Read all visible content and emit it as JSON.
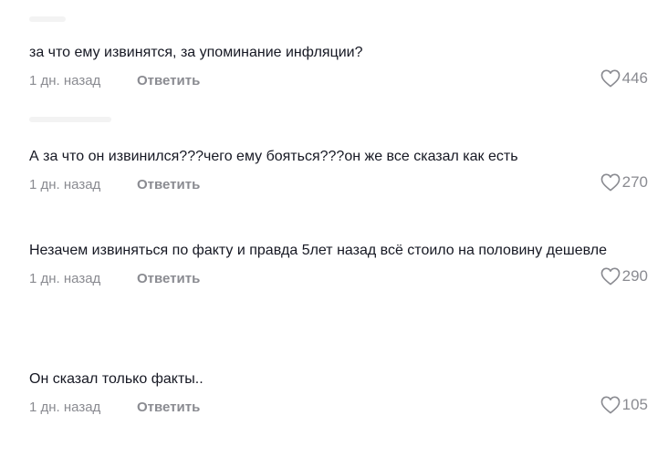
{
  "comments": [
    {
      "text": "за что ему извинятся, за упоминание инфляции?",
      "time": "1 дн. назад",
      "reply_label": "Ответить",
      "likes": "446"
    },
    {
      "text": "А за что он извинился???чего ему бояться???он же все сказал как есть",
      "time": "1 дн. назад",
      "reply_label": "Ответить",
      "likes": "270"
    },
    {
      "text": "Незачем извиняться по факту и правда 5лет назад всё стоило на половину дешевле",
      "time": "1 дн. назад",
      "reply_label": "Ответить",
      "likes": "290"
    },
    {
      "text": "Он сказал только факты..",
      "time": "1 дн. назад",
      "reply_label": "Ответить",
      "likes": "105"
    }
  ],
  "icons": {
    "like": "heart-outline-icon"
  },
  "colors": {
    "text": "#161823",
    "muted": "#8a8b91",
    "background": "#ffffff"
  }
}
